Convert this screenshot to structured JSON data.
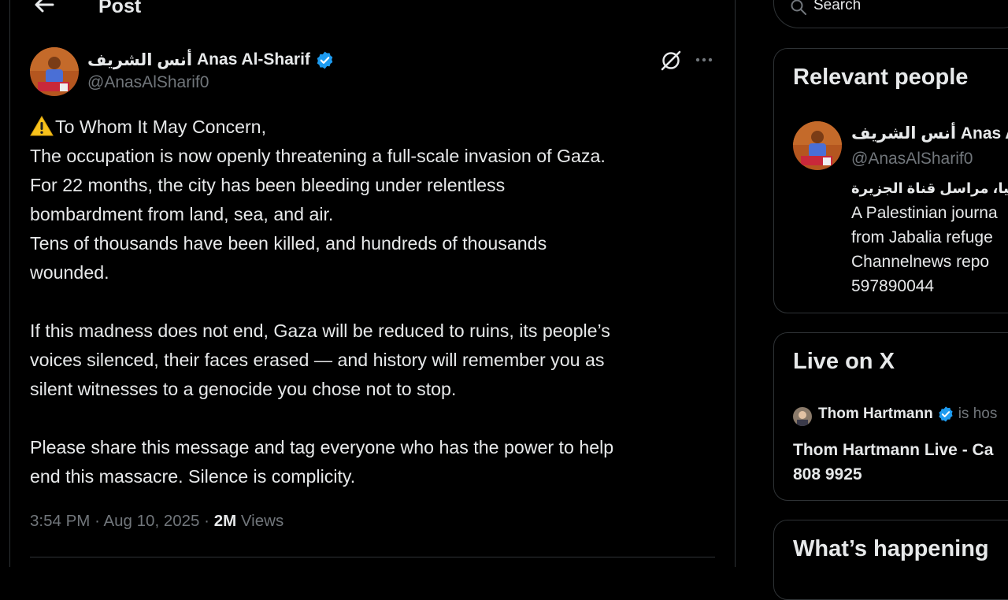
{
  "header": {
    "title": "Post"
  },
  "post": {
    "author_arabic": "أنس الشريف",
    "author_name": "Anas Al-Sharif",
    "handle": "@AnasAlSharif0",
    "lines": [
      "To Whom It May Concern,",
      "The occupation is now openly threatening a full-scale invasion of Gaza.",
      "For 22 months, the city has been bleeding under relentless",
      "bombardment from land, sea, and air.",
      "Tens of thousands have been killed, and hundreds of thousands",
      "wounded.",
      "If this madness does not end, Gaza will be reduced to ruins, its people’s",
      "voices silenced, their faces erased — and history will remember you as",
      "silent witnesses to a genocide you chose not to stop.",
      "Please share this message and tag everyone who has the power to help",
      "end this massacre. Silence is complicity."
    ],
    "time": "3:54 PM",
    "separator": "·",
    "date": "Aug 10, 2025",
    "views_count": "2M",
    "views_label": "Views"
  },
  "sidebar": {
    "search_placeholder": "Search",
    "relevant_people": {
      "title": "Relevant people",
      "person": {
        "arabic_name": "أنس الشريف",
        "name": "Anas Al...",
        "handle": "@AnasAlSharif0",
        "bio_arabic": "م جباليا، مراسل قناة الجزيرة",
        "bio_lines": [
          "A Palestinian journa",
          "from Jabalia refuge",
          "Channelnews repo",
          "597890044"
        ]
      }
    },
    "live": {
      "title": "Live on X",
      "host": "Thom Hartmann",
      "hosting_text": "is hos",
      "show_line1": "Thom Hartmann Live - Ca",
      "show_line2": "808 9925"
    },
    "whats_happening": {
      "title": "What’s happening"
    }
  },
  "colors": {
    "background": "#000000",
    "text_primary": "#e7e9ea",
    "text_secondary": "#71767b",
    "border": "#2f3336",
    "verified_blue": "#1d9bf0"
  },
  "icons": {
    "back": "arrow-left-icon",
    "verified": "verified-badge-icon",
    "grok": "grok-icon",
    "more": "more-horizontal-icon",
    "warning": "warning-emoji-icon",
    "search": "search-icon"
  }
}
